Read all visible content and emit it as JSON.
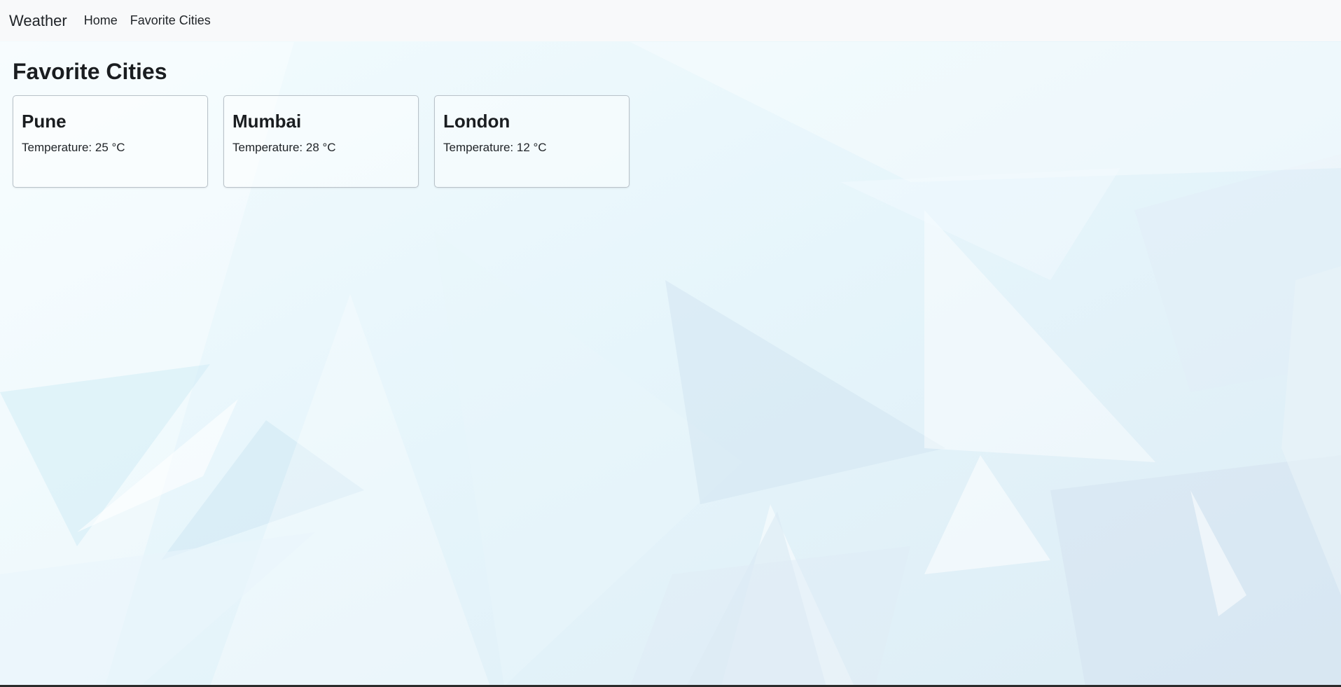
{
  "navbar": {
    "brand": "Weather",
    "links": [
      "Home",
      "Favorite Cities"
    ]
  },
  "page": {
    "title": "Favorite Cities"
  },
  "cities": [
    {
      "name": "Pune",
      "temperature": "Temperature: 25 °C"
    },
    {
      "name": "Mumbai",
      "temperature": "Temperature: 28 °C"
    },
    {
      "name": "London",
      "temperature": "Temperature: 12 °C"
    }
  ],
  "colors": {
    "navbar_bg": "#f8f9fa",
    "text": "#212529",
    "card_border": "#b9c2c9",
    "background_tint": "#d8eef8"
  },
  "icons": {
    "background": "abstract-triangles-background"
  }
}
